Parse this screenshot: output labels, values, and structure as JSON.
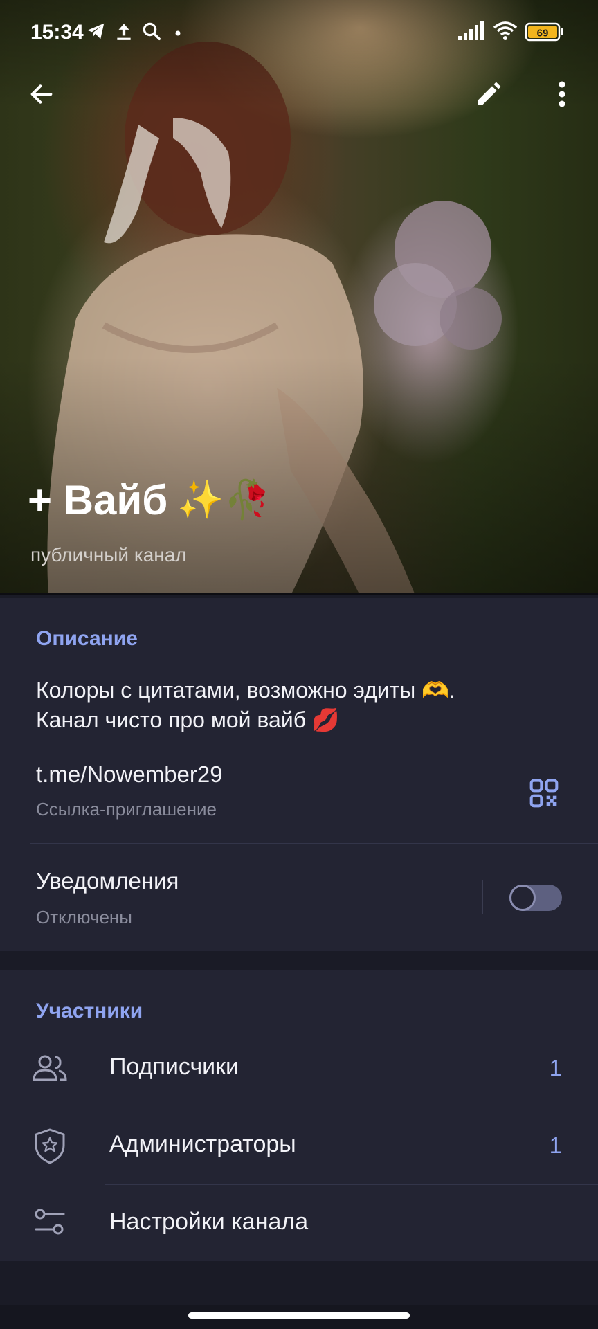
{
  "status_bar": {
    "time": "15:34",
    "battery": "69",
    "icons": [
      "telegram-icon",
      "upload-icon",
      "search-icon",
      "dot-icon",
      "signal-icon",
      "wifi-icon",
      "battery-icon"
    ]
  },
  "top_bar": {
    "back_icon": "arrow-left-icon",
    "edit_icon": "pencil-icon",
    "menu_icon": "more-vertical-icon"
  },
  "header": {
    "title": "+ Вайб",
    "title_emoji": "✨🥀",
    "subtitle": "публичный канал"
  },
  "info": {
    "section_title": "Описание",
    "description_line1": "Колоры с цитатами, возможно эдиты 🫶.",
    "description_line2": "Канал чисто про мой вайб 💋",
    "link": "t.me/Nowember29",
    "link_caption": "Ссылка-приглашение",
    "qr_icon": "qr-code-icon",
    "notifications_label": "Уведомления",
    "notifications_status": "Отключены",
    "notifications_enabled": false
  },
  "members": {
    "section_title": "Участники",
    "items": [
      {
        "label": "Подписчики",
        "count": "1",
        "icon": "users-icon"
      },
      {
        "label": "Администраторы",
        "count": "1",
        "icon": "shield-star-icon"
      },
      {
        "label": "Настройки канала",
        "count": "",
        "icon": "sliders-icon"
      }
    ]
  },
  "colors": {
    "accent": "#8fa4f0",
    "card_bg": "#232433",
    "page_bg": "#1a1b26"
  }
}
